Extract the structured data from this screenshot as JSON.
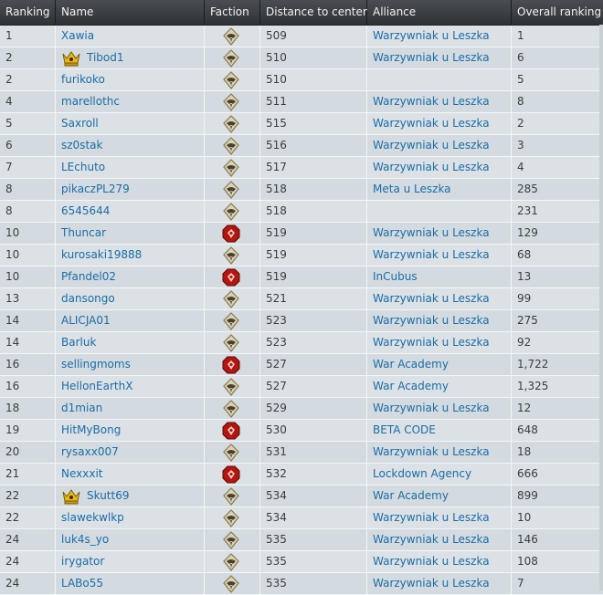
{
  "headers": {
    "ranking": "Ranking",
    "name": "Name",
    "faction": "Faction",
    "distance": "Distance to center",
    "alliance": "Alliance",
    "overall": "Overall ranking"
  },
  "factions": {
    "gdi": {
      "icon": "gdi-eagle-icon",
      "color": "#8a7a4e"
    },
    "nod": {
      "icon": "nod-scorpion-icon",
      "color": "#b3150f"
    }
  },
  "rows": [
    {
      "rank": "1",
      "name": "Xawia",
      "crown": false,
      "faction": "gdi",
      "distance": "509",
      "alliance": "Warzywniak u Leszka",
      "overall": "1"
    },
    {
      "rank": "2",
      "name": "Tibod1",
      "crown": true,
      "faction": "gdi",
      "distance": "510",
      "alliance": "Warzywniak u Leszka",
      "overall": "6"
    },
    {
      "rank": "2",
      "name": "furikoko",
      "crown": false,
      "faction": "gdi",
      "distance": "510",
      "alliance": "",
      "overall": "5"
    },
    {
      "rank": "4",
      "name": "marellothc",
      "crown": false,
      "faction": "gdi",
      "distance": "511",
      "alliance": "Warzywniak u Leszka",
      "overall": "8"
    },
    {
      "rank": "5",
      "name": "Saxroll",
      "crown": false,
      "faction": "gdi",
      "distance": "515",
      "alliance": "Warzywniak u Leszka",
      "overall": "2"
    },
    {
      "rank": "6",
      "name": "sz0stak",
      "crown": false,
      "faction": "gdi",
      "distance": "516",
      "alliance": "Warzywniak u Leszka",
      "overall": "3"
    },
    {
      "rank": "7",
      "name": "LEchuto",
      "crown": false,
      "faction": "gdi",
      "distance": "517",
      "alliance": "Warzywniak u Leszka",
      "overall": "4"
    },
    {
      "rank": "8",
      "name": "pikaczPL279",
      "crown": false,
      "faction": "gdi",
      "distance": "518",
      "alliance": "Meta u Leszka",
      "overall": "285"
    },
    {
      "rank": "8",
      "name": "6545644",
      "crown": false,
      "faction": "gdi",
      "distance": "518",
      "alliance": "",
      "overall": "231"
    },
    {
      "rank": "10",
      "name": "Thuncar",
      "crown": false,
      "faction": "nod",
      "distance": "519",
      "alliance": "Warzywniak u Leszka",
      "overall": "129"
    },
    {
      "rank": "10",
      "name": "kurosaki19888",
      "crown": false,
      "faction": "gdi",
      "distance": "519",
      "alliance": "Warzywniak u Leszka",
      "overall": "68"
    },
    {
      "rank": "10",
      "name": "Pfandel02",
      "crown": false,
      "faction": "nod",
      "distance": "519",
      "alliance": "InCubus",
      "overall": "13"
    },
    {
      "rank": "13",
      "name": "dansongo",
      "crown": false,
      "faction": "gdi",
      "distance": "521",
      "alliance": "Warzywniak u Leszka",
      "overall": "99"
    },
    {
      "rank": "14",
      "name": "ALICJA01",
      "crown": false,
      "faction": "gdi",
      "distance": "523",
      "alliance": "Warzywniak u Leszka",
      "overall": "275"
    },
    {
      "rank": "14",
      "name": "Barluk",
      "crown": false,
      "faction": "gdi",
      "distance": "523",
      "alliance": "Warzywniak u Leszka",
      "overall": "92"
    },
    {
      "rank": "16",
      "name": "sellingmoms",
      "crown": false,
      "faction": "nod",
      "distance": "527",
      "alliance": "War Academy",
      "overall": "1,722"
    },
    {
      "rank": "16",
      "name": "HellonEarthX",
      "crown": false,
      "faction": "gdi",
      "distance": "527",
      "alliance": "War Academy",
      "overall": "1,325"
    },
    {
      "rank": "18",
      "name": "d1mian",
      "crown": false,
      "faction": "gdi",
      "distance": "529",
      "alliance": "Warzywniak u Leszka",
      "overall": "12"
    },
    {
      "rank": "19",
      "name": "HitMyBong",
      "crown": false,
      "faction": "nod",
      "distance": "530",
      "alliance": "BETA CODE",
      "overall": "648"
    },
    {
      "rank": "20",
      "name": "rysaxx007",
      "crown": false,
      "faction": "gdi",
      "distance": "531",
      "alliance": "Warzywniak u Leszka",
      "overall": "18"
    },
    {
      "rank": "21",
      "name": "Nexxxit",
      "crown": false,
      "faction": "nod",
      "distance": "532",
      "alliance": "Lockdown Agency",
      "overall": "666"
    },
    {
      "rank": "22",
      "name": "Skutt69",
      "crown": true,
      "faction": "gdi",
      "distance": "534",
      "alliance": "War Academy",
      "overall": "899"
    },
    {
      "rank": "22",
      "name": "slawekwlkp",
      "crown": false,
      "faction": "gdi",
      "distance": "534",
      "alliance": "Warzywniak u Leszka",
      "overall": "10"
    },
    {
      "rank": "24",
      "name": "luk4s_yo",
      "crown": false,
      "faction": "gdi",
      "distance": "535",
      "alliance": "Warzywniak u Leszka",
      "overall": "146"
    },
    {
      "rank": "24",
      "name": "irygator",
      "crown": false,
      "faction": "gdi",
      "distance": "535",
      "alliance": "Warzywniak u Leszka",
      "overall": "108"
    },
    {
      "rank": "24",
      "name": "LABo55",
      "crown": false,
      "faction": "gdi",
      "distance": "535",
      "alliance": "Warzywniak u Leszka",
      "overall": "7"
    }
  ]
}
